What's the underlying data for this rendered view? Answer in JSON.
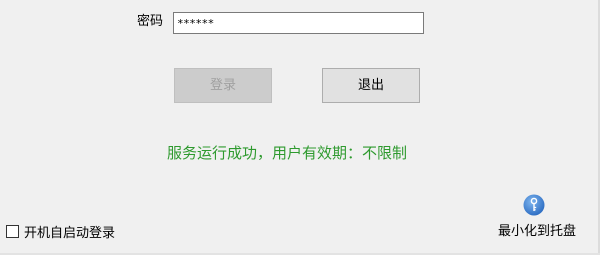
{
  "login": {
    "password_label": "密码",
    "password_value": "******",
    "login_button": "登录",
    "exit_button": "退出"
  },
  "status": {
    "message": "服务运行成功，用户有效期：不限制",
    "color": "#2e9a2e"
  },
  "footer": {
    "autostart_label": "开机自启动登录",
    "autostart_checked": false,
    "tray_icon": "key-icon",
    "minimize_label": "最小化到托盘"
  }
}
